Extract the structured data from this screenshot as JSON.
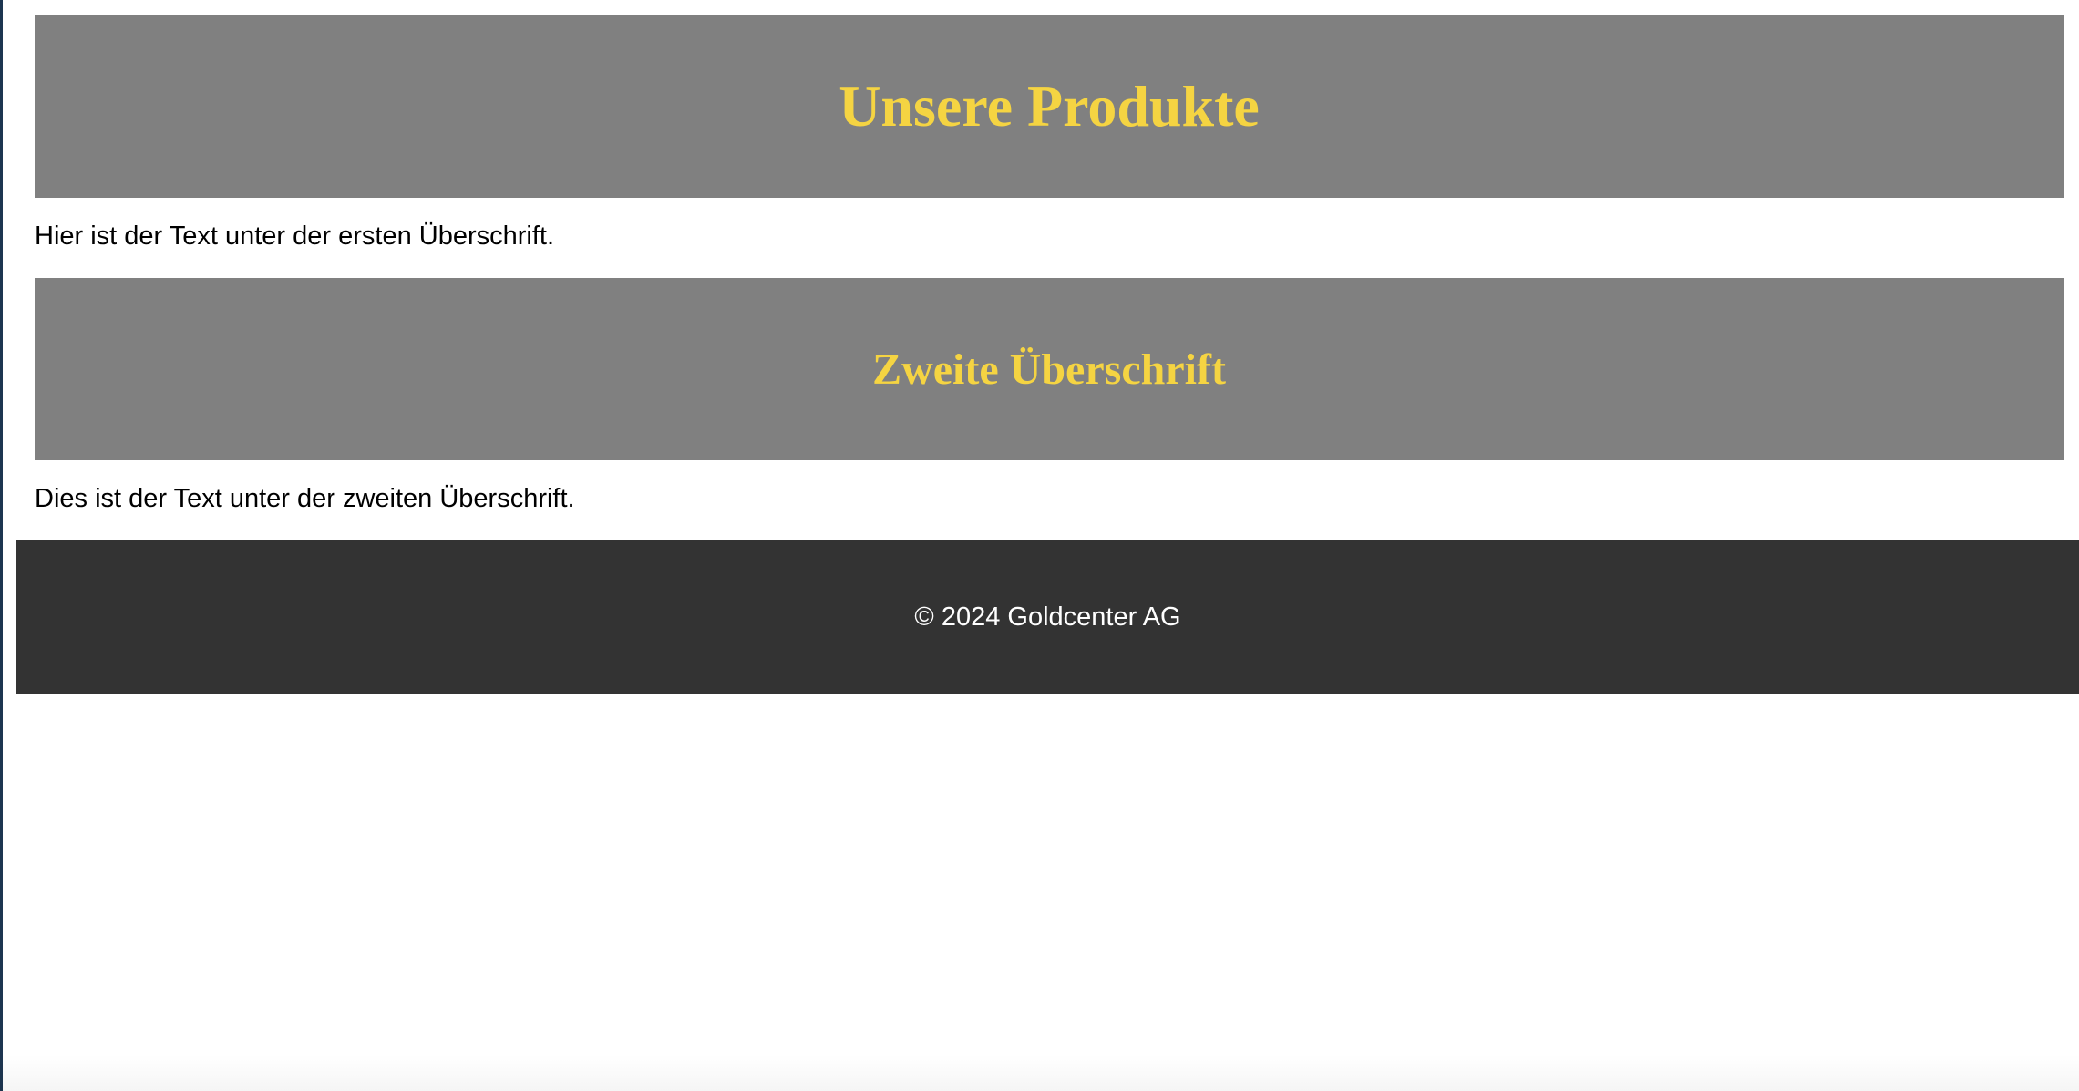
{
  "sections": [
    {
      "heading": "Unsere Produkte",
      "text": "Hier ist der Text unter der ersten Überschrift."
    },
    {
      "heading": "Zweite Überschrift",
      "text": "Dies ist der Text unter der zweiten Überschrift."
    }
  ],
  "footer": {
    "copyright": "© 2024 Goldcenter AG"
  },
  "colors": {
    "heading_bg": "#808080",
    "heading_text": "#f5d442",
    "footer_bg": "#333333"
  }
}
